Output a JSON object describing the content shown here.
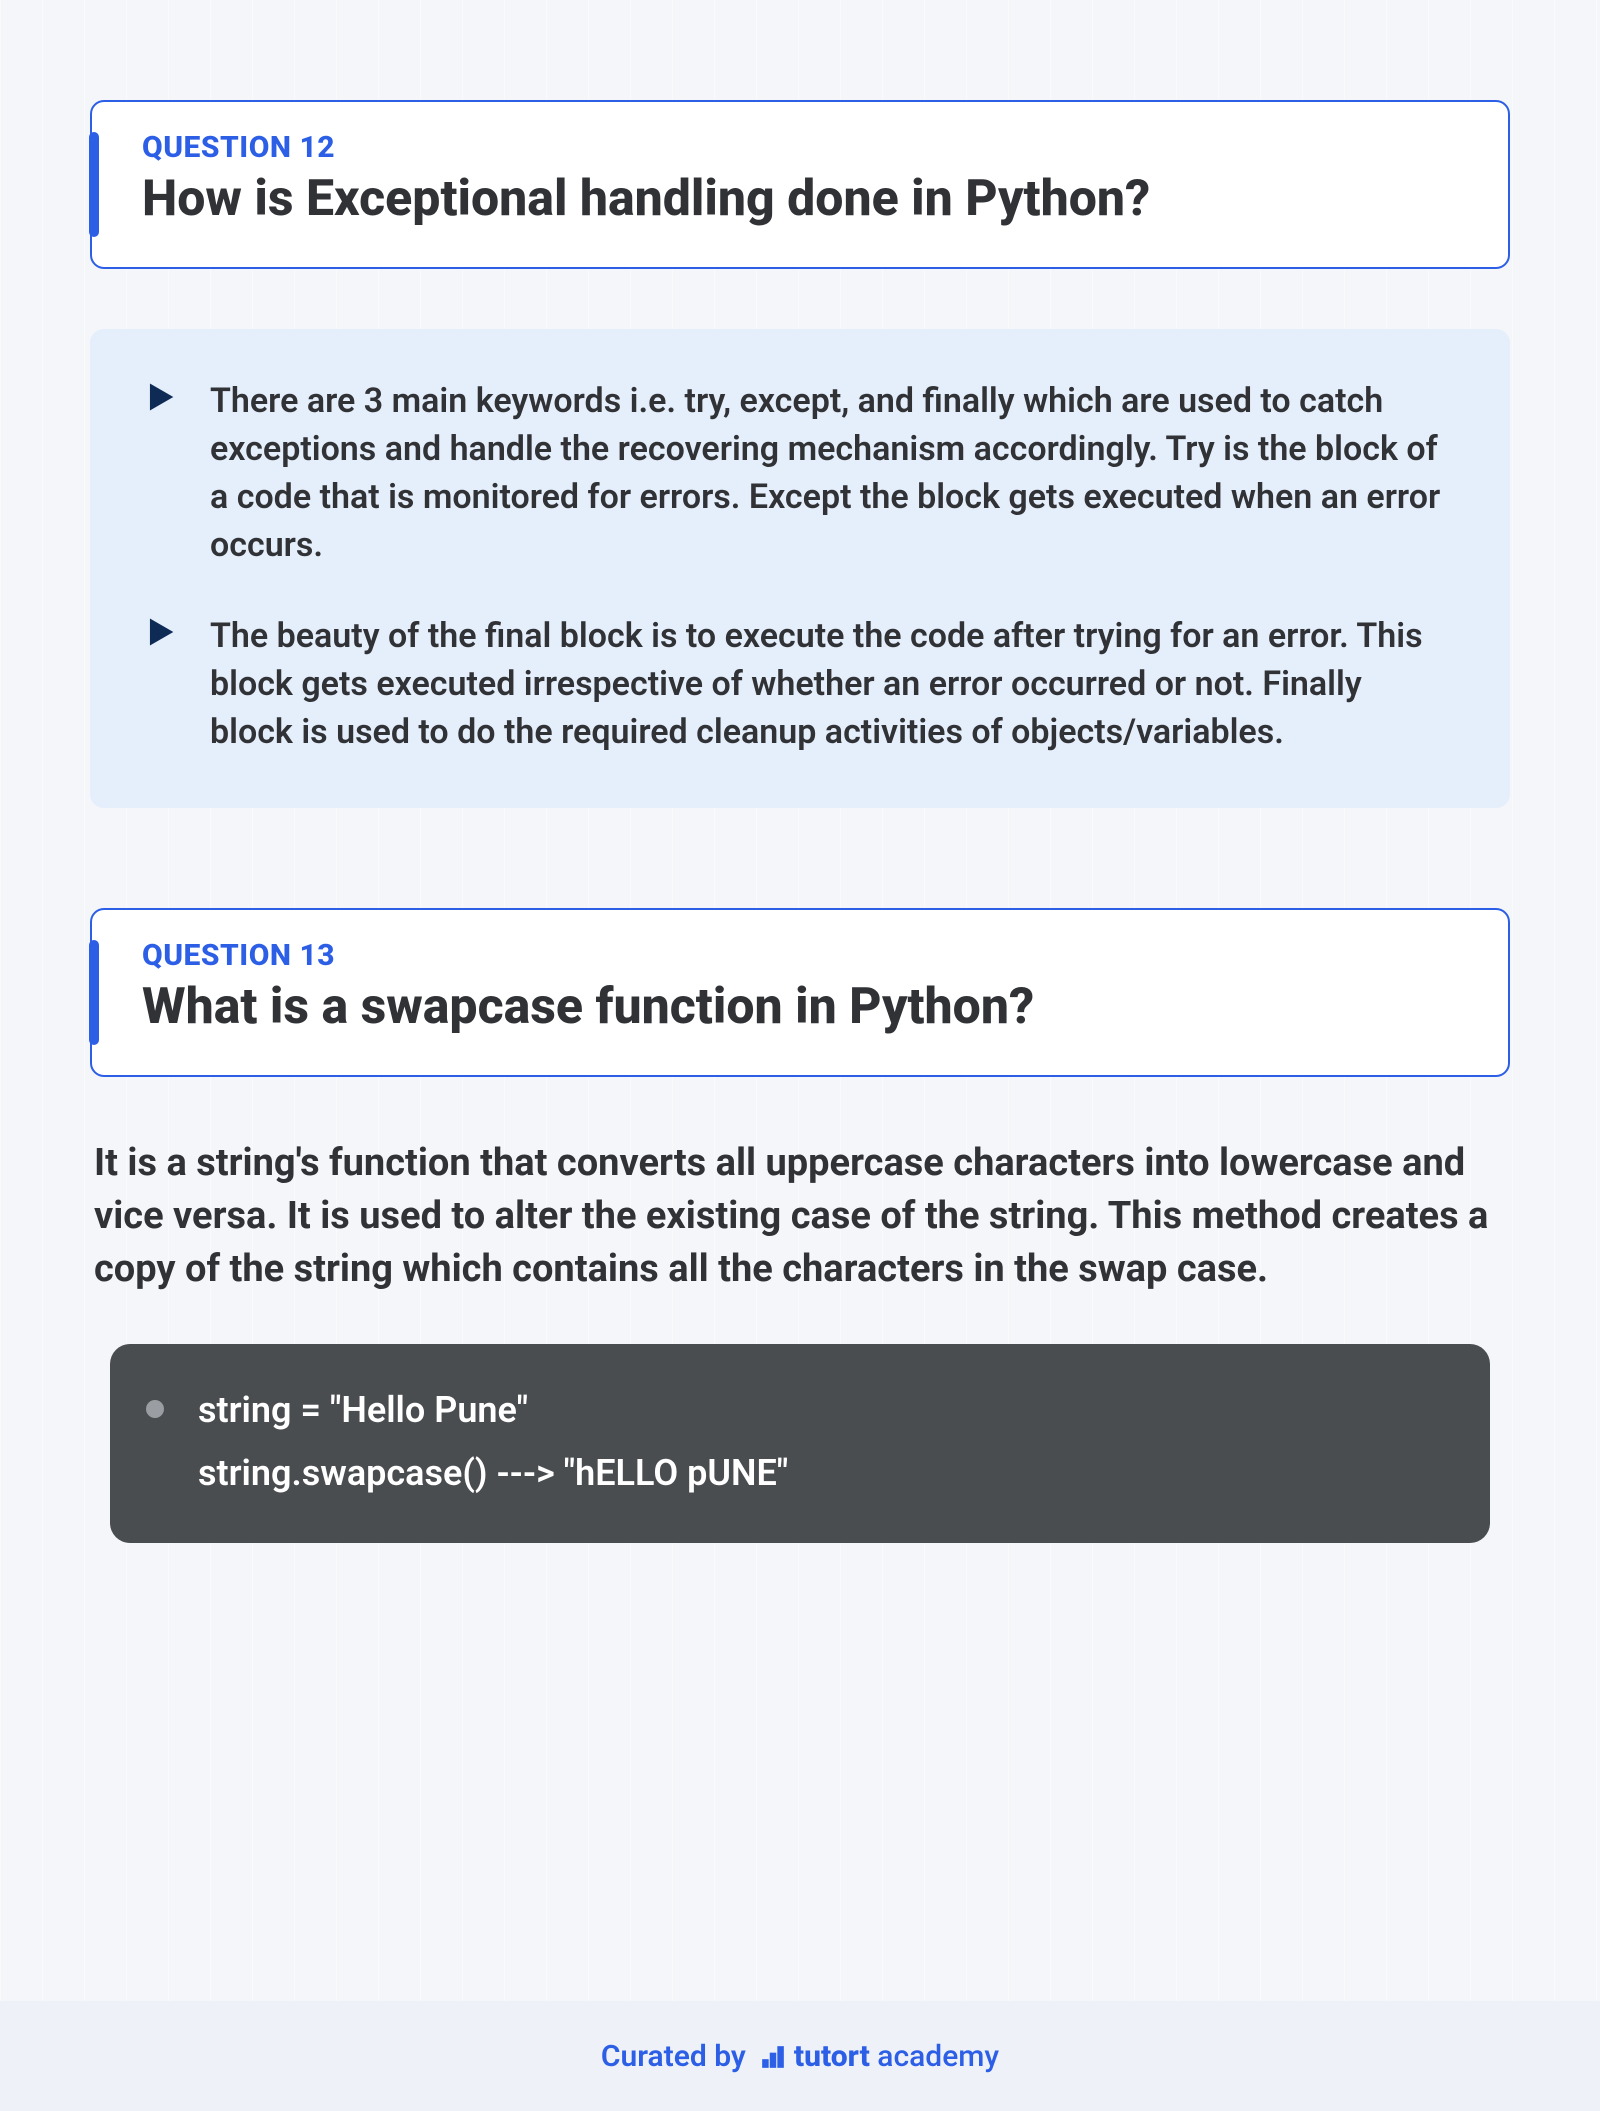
{
  "question12": {
    "label": "QUESTION 12",
    "title": "How is Exceptional handling done in Python?",
    "bullets": [
      "There are 3 main keywords i.e. try, except, and finally which are used to catch exceptions and handle the recovering mechanism accordingly. Try is the block of a code that is monitored for errors. Except the block gets executed when an error occurs.",
      "The beauty of the final block is to execute the code after trying for an error. This block gets executed irrespective of whether an error occurred or not. Finally block is used to do the required cleanup activities of objects/variables."
    ]
  },
  "question13": {
    "label": "QUESTION 13",
    "title": "What is a swapcase function in Python?",
    "answer": "It is a string's function that converts all uppercase characters into lowercase and vice versa. It is used to alter the existing case of the string. This method creates a copy of the string which contains all the characters in the swap case.",
    "code": {
      "line1": "string = \"Hello Pune\"",
      "line2": "string.swapcase() ---> \"hELLO pUNE\""
    }
  },
  "footer": {
    "curated": "Curated by",
    "brand_bold": "tutort",
    "brand_light": " academy"
  }
}
